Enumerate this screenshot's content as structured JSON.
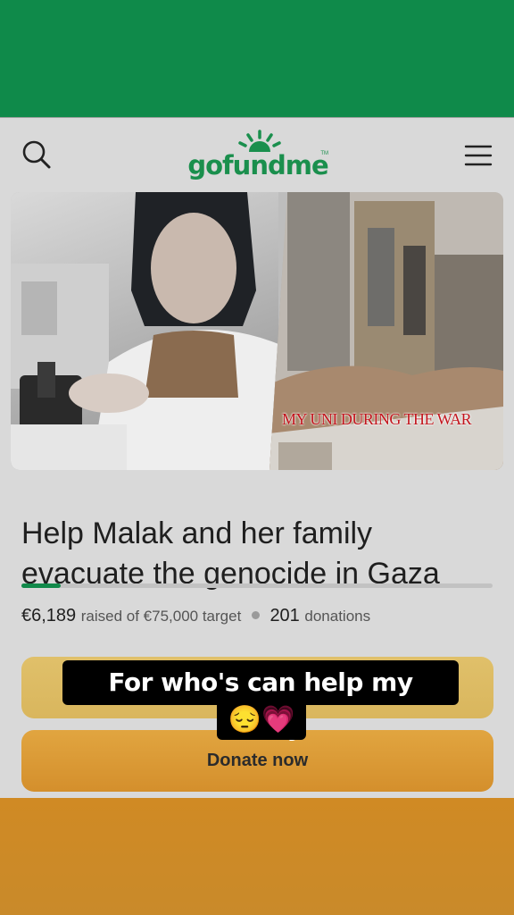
{
  "header": {
    "logo_text": "gofundme",
    "tm": "TM"
  },
  "hero": {
    "caption": "MY UNI DURING THE WAR"
  },
  "campaign": {
    "title": "Help Malak and her family evacuate the genocide in Gaza",
    "raised_amount": "€6,189",
    "raised_label": "raised of €75,000 target",
    "donations_count": "201",
    "donations_label": "donations",
    "progress_fraction": 0.083
  },
  "actions": {
    "donate_label": "Donate now"
  },
  "overlay": {
    "line1": "For who's can help my family",
    "line2": "😔💗"
  },
  "colors": {
    "brand_green": "#0f8a4a",
    "donate_orange": "#d8962f",
    "share_gold": "#dcbb62"
  }
}
